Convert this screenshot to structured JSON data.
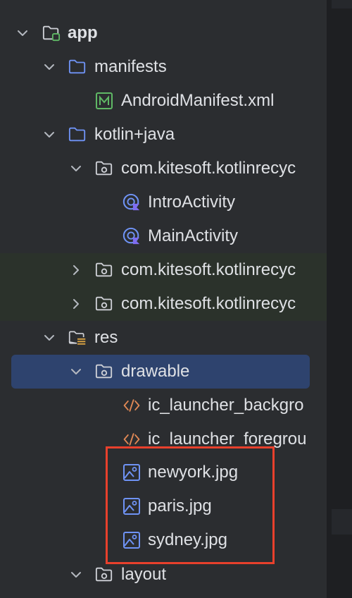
{
  "colors": {
    "background": "#2b2d30",
    "selected_row": "#2e436e",
    "highlight_border": "#e8402c",
    "folder_icon": "#6f93f5",
    "text": "#dfe1e5",
    "manifest_icon": "#5fb865",
    "kotlin_icon": "#7f6cf0"
  },
  "tree": {
    "app": {
      "label": "app",
      "icon": "module-folder-icon"
    },
    "manifests": {
      "label": "manifests",
      "icon": "folder-icon"
    },
    "android_manifest": {
      "label": "AndroidManifest.xml",
      "icon": "manifest-icon"
    },
    "kotlin_java": {
      "label": "kotlin+java",
      "icon": "folder-icon"
    },
    "pkg_main": {
      "label": "com.kitesoft.kotlinrecyc",
      "icon": "package-icon"
    },
    "intro_activity": {
      "label": "IntroActivity",
      "icon": "kotlin-class-icon"
    },
    "main_activity": {
      "label": "MainActivity",
      "icon": "kotlin-class-icon"
    },
    "pkg_test1": {
      "label": "com.kitesoft.kotlinrecyc",
      "icon": "package-icon"
    },
    "pkg_test2": {
      "label": "com.kitesoft.kotlinrecyc",
      "icon": "package-icon"
    },
    "res": {
      "label": "res",
      "icon": "resource-folder-icon"
    },
    "drawable": {
      "label": "drawable",
      "icon": "package-icon"
    },
    "ic_bg": {
      "label": "ic_launcher_backgro",
      "icon": "xml-icon"
    },
    "ic_fg": {
      "label": "ic_launcher_foregrou",
      "icon": "xml-icon"
    },
    "newyork": {
      "label": "newyork.jpg",
      "icon": "image-icon"
    },
    "paris": {
      "label": "paris.jpg",
      "icon": "image-icon"
    },
    "sydney": {
      "label": "sydney.jpg",
      "icon": "image-icon"
    },
    "layout": {
      "label": "layout",
      "icon": "package-icon"
    }
  }
}
